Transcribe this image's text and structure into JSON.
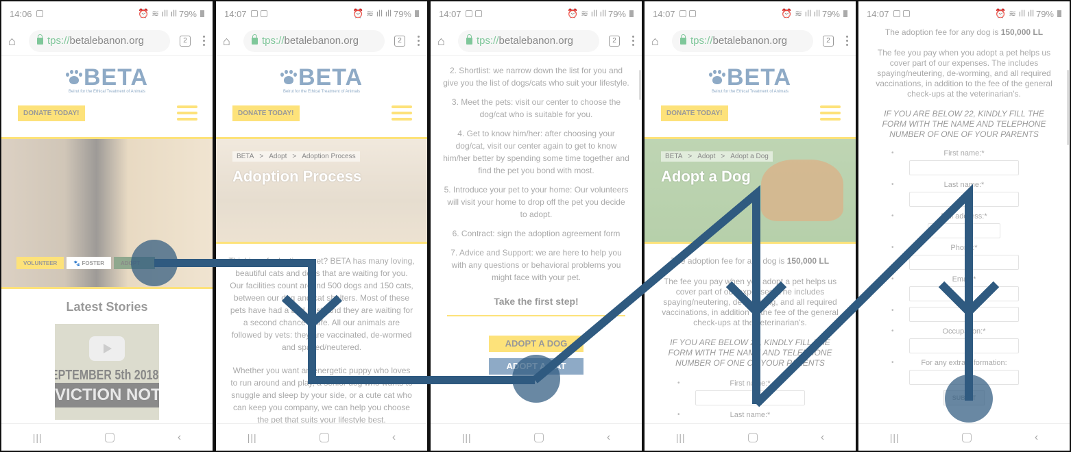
{
  "browser": {
    "url_scheme": "tps://",
    "url_host": "betalebanon.org",
    "tab_count": "2",
    "battery": "79%"
  },
  "site": {
    "logo_text": "BETA",
    "logo_sub": "Beirut for the Ethical Treatment of Animals",
    "donate_label": "DONATE TODAY!"
  },
  "panels": [
    {
      "time": "14:06",
      "cta": {
        "volunteer": "VOLUNTEER",
        "foster": "FOSTER",
        "adopt": "ADOPT"
      },
      "latest_stories_title": "Latest Stories",
      "video_line1": "EPTEMBER 5th 2018",
      "video_line2": "VICTION NOTICE"
    },
    {
      "time": "14:07",
      "breadcrumb": [
        "BETA",
        ">",
        "Adopt",
        ">",
        "Adoption Process"
      ],
      "hero_title": "Adoption Process",
      "paragraph1": "Thinking of adopting a pet? BETA has many loving, beautiful cats and dogs that are waiting for you. Our facilities count around 500 dogs and 150 cats, between our dog and cat shelters. Most of these pets have had a bad past, and they are waiting for a second chance at life. All our animals are followed by vets: they are vaccinated, de-wormed and spayed/neutered.",
      "paragraph2": "Whether you want an energetic puppy who loves to run around and play, a senior dog who wants to snuggle and sleep by your side, or a cute cat who can keep you company, we can help you choose the pet that suits your lifestyle best."
    },
    {
      "time": "14:07",
      "steps": [
        "2. Shortlist: we narrow down the list for you and give you the list of dogs/cats who suit your lifestyle.",
        "3. Meet the pets: visit our center to choose the dog/cat who is suitable for you.",
        "4. Get to know him/her: after choosing your dog/cat, visit our center again to get to know him/her better by spending some time together and find the pet you bond with most.",
        "5. Introduce your pet to your home: Our volunteers will visit your home to drop off the pet you decide to adopt.",
        "6. Contract: sign the adoption agreement form",
        "7. Advice and Support: we are here to help you with any questions or behavioral problems you might face with your pet."
      ],
      "take_first_step": "Take the first step!",
      "adopt_dog": "ADOPT A DOG",
      "adopt_cat": "ADOPT A CAT"
    },
    {
      "time": "14:07",
      "breadcrumb": [
        "BETA",
        ">",
        "Adopt",
        ">",
        "Adopt a Dog"
      ],
      "hero_title": "Adopt a Dog",
      "fee_prefix": "The adoption fee for any dog is ",
      "fee_amount": "150,000 LL",
      "fee_text": "The fee you pay when you adopt a pet helps us cover part of our expenses. The includes spaying/neutering, de-worming, and all required vaccinations, in addition to the fee of the general check-ups at the veterinarian's.",
      "note": "IF YOU ARE BELOW 22, KINDLY FILL THE FORM WITH THE NAME AND TELEPHONE NUMBER OF ONE OF YOUR PARENTS",
      "form_labels": [
        "First name:*",
        "Last name:*"
      ]
    },
    {
      "time": "14:07",
      "fee_prefix": "The adoption fee for any dog is ",
      "fee_amount": "150,000 LL",
      "fee_text": "The fee you pay when you adopt a pet helps us cover part of our expenses. The includes spaying/neutering, de-worming, and all required vaccinations, in addition to the fee of the general check-ups at the veterinarian's.",
      "note": "IF YOU ARE BELOW 22, KINDLY FILL THE FORM WITH THE NAME AND TELEPHONE NUMBER OF ONE OF YOUR PARENTS",
      "form_labels": [
        "First name:*",
        "Last name:*",
        "Full address:*",
        "Phone:*",
        "Email:*",
        "",
        "Occupation:*",
        "For any extra information:"
      ],
      "form_values": [
        "",
        "",
        "",
        "",
        "",
        "",
        "",
        ""
      ],
      "submit": "SUBMIT"
    }
  ],
  "gesture": {
    "color": "#2f5a80"
  }
}
